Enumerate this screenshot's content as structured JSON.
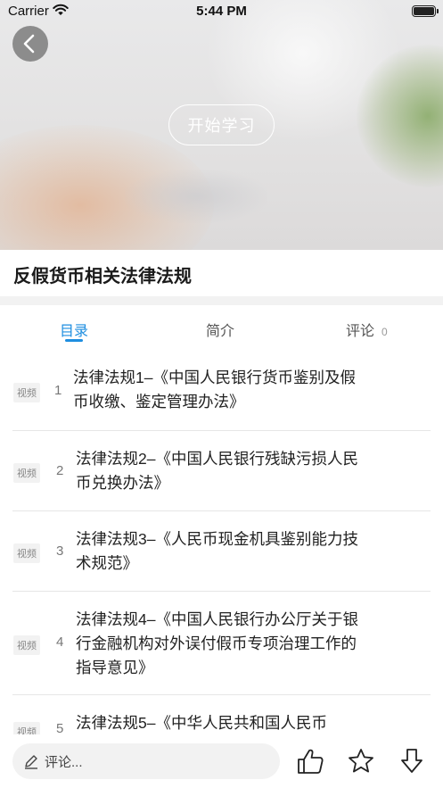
{
  "status_bar": {
    "carrier": "Carrier",
    "time": "5:44 PM"
  },
  "hero": {
    "start_label": "开始学习"
  },
  "course": {
    "title": "反假货币相关法律法规"
  },
  "tabs": [
    {
      "label": "目录",
      "active": true
    },
    {
      "label": "简介",
      "active": false
    },
    {
      "label": "评论",
      "count": "0",
      "active": false
    }
  ],
  "items": [
    {
      "badge": "视频",
      "num": "1",
      "title": "法律法规1–《中国人民银行货币鉴别及假币收缴、鉴定管理办法》"
    },
    {
      "badge": "视频",
      "num": "2",
      "title": "法律法规2–《中国人民银行残缺污损人民币兑换办法》"
    },
    {
      "badge": "视频",
      "num": "3",
      "title": "法律法规3–《人民币现金机具鉴别能力技术规范》"
    },
    {
      "badge": "视频",
      "num": "4",
      "title": "法律法规4–《中国人民银行办公厅关于银行金融机构对外误付假币专项治理工作的指导意见》"
    },
    {
      "badge": "视频",
      "num": "5",
      "title": "法律法规5–《中华人民共和国人民币"
    }
  ],
  "bottom": {
    "comment_placeholder": "评论..."
  },
  "colors": {
    "accent": "#1e8ee0"
  },
  "icons": [
    "back-arrow-icon",
    "wifi-icon",
    "battery-icon",
    "pen-icon",
    "thumb-up-icon",
    "star-icon",
    "download-icon"
  ]
}
